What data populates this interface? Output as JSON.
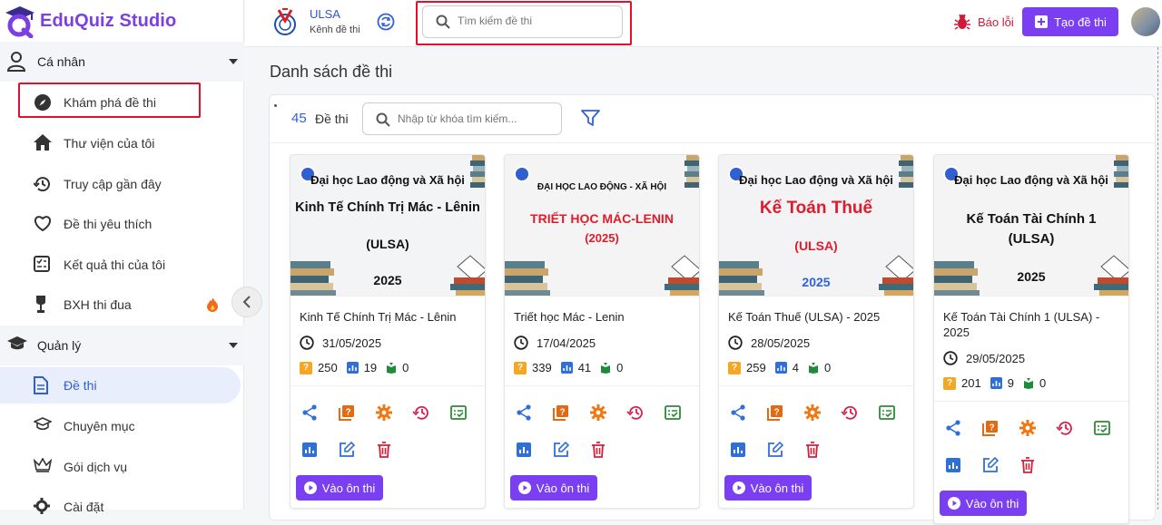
{
  "app": {
    "name": "EduQuiz Studio"
  },
  "sidebar": {
    "personal_section": "Cá nhân",
    "personal_items": [
      {
        "label": "Khám phá đề thi"
      },
      {
        "label": "Thư viện của tôi"
      },
      {
        "label": "Truy cập gần đây"
      },
      {
        "label": "Đề thi yêu thích"
      },
      {
        "label": "Kết quả thi của tôi"
      },
      {
        "label": "BXH thi đua"
      }
    ],
    "manage_section": "Quản lý",
    "manage_items": [
      {
        "label": "Đề thi"
      },
      {
        "label": "Chuyên mục"
      },
      {
        "label": "Gói dịch vụ"
      },
      {
        "label": "Cài đặt"
      }
    ]
  },
  "header": {
    "channel_name": "ULSA",
    "channel_sub": "Kênh đề thi",
    "search_placeholder": "Tìm kiếm đề thi",
    "report_label": "Báo lỗi",
    "create_label": "Tạo đề thi"
  },
  "main": {
    "title": "Danh sách đề thi",
    "count": "45",
    "count_label": "Đề thi",
    "search_placeholder": "Nhập từ khóa tìm kiếm...",
    "review_label": "Vào ôn thi",
    "cards": [
      {
        "thumb_line1": "Đại học Lao động và Xã hội",
        "thumb_title": "Kinh Tế Chính Trị Mác - Lênin",
        "thumb_sub": "(ULSA)",
        "thumb_year": "2025",
        "title": "Kinh Tế Chính Trị Mác - Lênin",
        "date": "31/05/2025",
        "questions": "250",
        "views": "19",
        "likes": "0"
      },
      {
        "thumb_line1": "ĐẠI HỌC LAO ĐỘNG - XÃ HỘI",
        "thumb_title": "TRIẾT HỌC MÁC-LENIN",
        "thumb_sub": "(2025)",
        "thumb_year": "",
        "title": "Triết học Mác - Lenin",
        "date": "17/04/2025",
        "questions": "339",
        "views": "41",
        "likes": "0"
      },
      {
        "thumb_line1": "Đại học Lao động và Xã hội",
        "thumb_title": "Kế Toán Thuế",
        "thumb_sub": "(ULSA)",
        "thumb_year": "2025",
        "title": "Kế Toán Thuế (ULSA) - 2025",
        "date": "28/05/2025",
        "questions": "259",
        "views": "4",
        "likes": "0"
      },
      {
        "thumb_line1": "Đại học Lao động và Xã hội",
        "thumb_title": "Kế Toán Tài Chính 1",
        "thumb_sub": "(ULSA)",
        "thumb_year": "2025",
        "title": "Kế Toán Tài Chính 1 (ULSA) - 2025",
        "date": "29/05/2025",
        "questions": "201",
        "views": "9",
        "likes": "0"
      }
    ]
  },
  "colors": {
    "accent": "#7b3ff2",
    "link": "#3160d8",
    "highlight_border": "#e0102e"
  }
}
